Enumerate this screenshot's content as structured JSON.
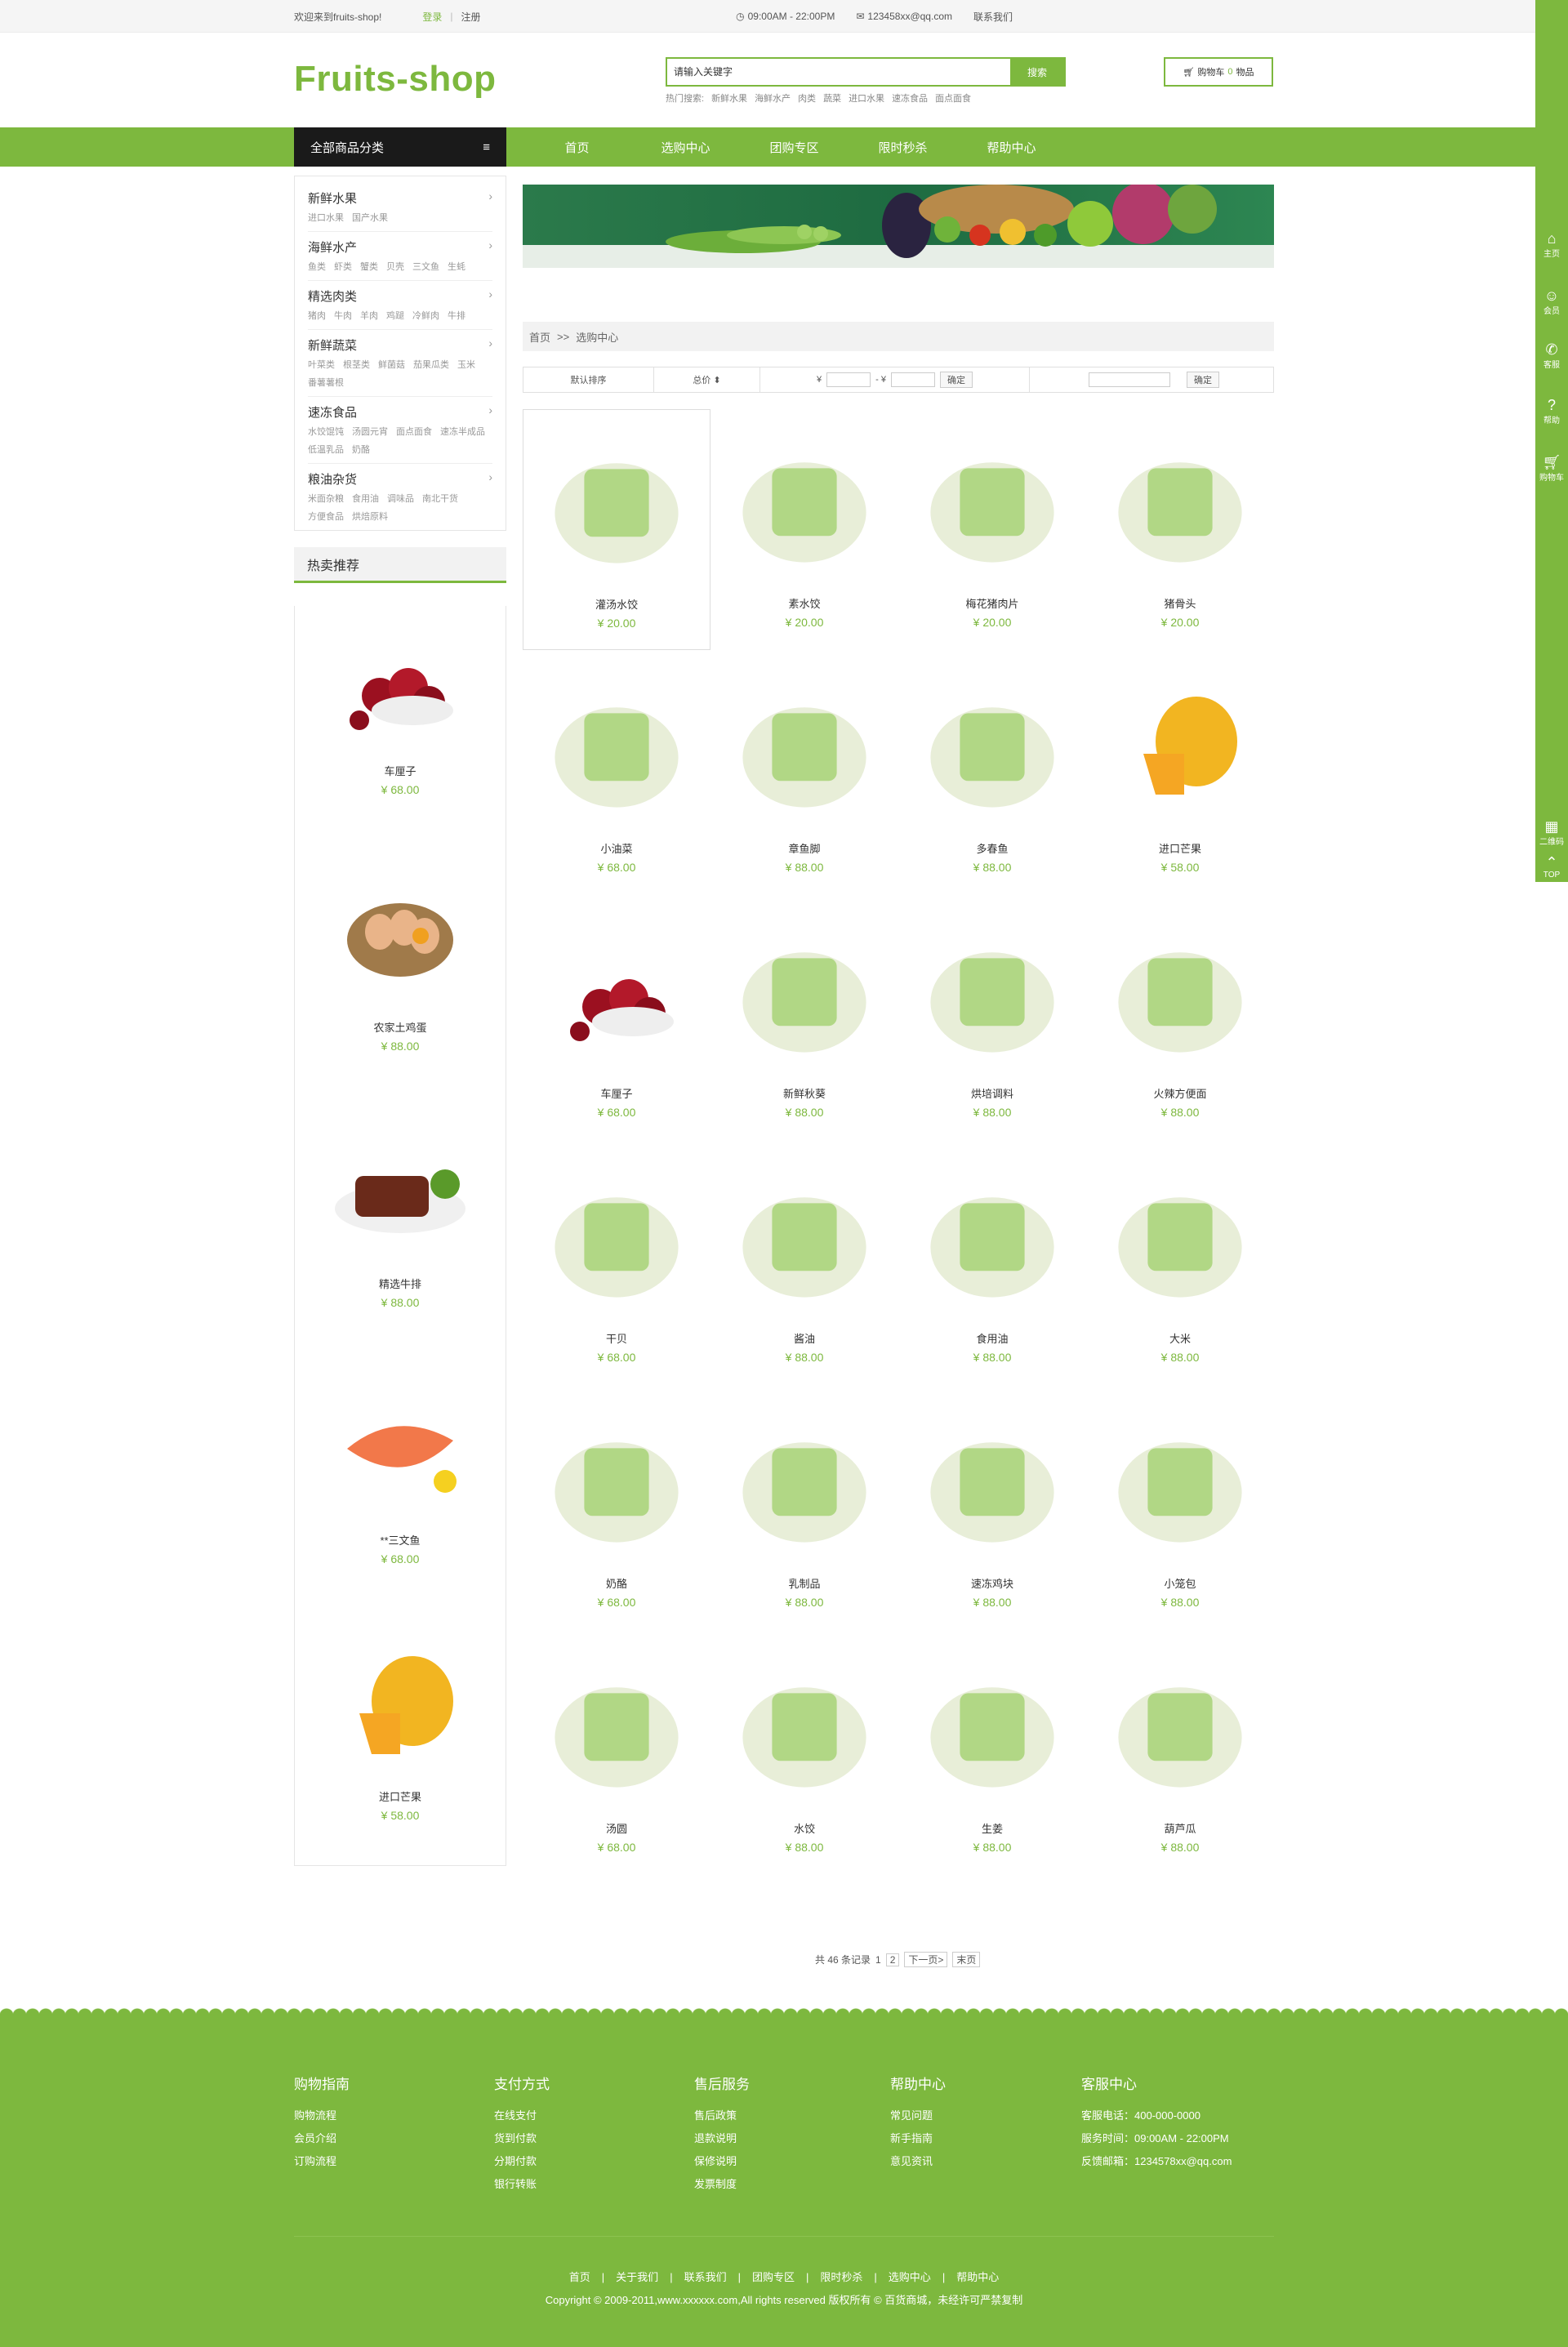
{
  "topbar": {
    "welcome": "欢迎来到fruits-shop!",
    "login": "登录",
    "register": "注册",
    "hours": "09:00AM - 22:00PM",
    "email": "123458xx@qq.com",
    "contact": "联系我们"
  },
  "logo": "Fruits-shop",
  "search": {
    "placeholder": "请输入关键字",
    "button": "搜索",
    "hot_label": "热门搜索:",
    "hot": [
      "新鲜水果",
      "海鲜水产",
      "肉类",
      "蔬菜",
      "进口水果",
      "速冻食品",
      "面点面食"
    ]
  },
  "cart": {
    "label": "购物车",
    "count": "0",
    "unit": "物品"
  },
  "nav": {
    "all_categories": "全部商品分类",
    "links": [
      "首页",
      "选购中心",
      "团购专区",
      "限时秒杀",
      "帮助中心"
    ]
  },
  "categories": [
    {
      "title": "新鲜水果",
      "subs": [
        "进口水果",
        "国产水果"
      ]
    },
    {
      "title": "海鲜水产",
      "subs": [
        "鱼类",
        "虾类",
        "蟹类",
        "贝壳",
        "三文鱼",
        "生蚝"
      ]
    },
    {
      "title": "精选肉类",
      "subs": [
        "猪肉",
        "牛肉",
        "羊肉",
        "鸡蹆",
        "冷鲜肉",
        "牛排"
      ]
    },
    {
      "title": "新鲜蔬菜",
      "subs": [
        "叶菜类",
        "根茎类",
        "鲜菌菇",
        "茄果瓜类",
        "玉米",
        "番薯薯根"
      ]
    },
    {
      "title": "速冻食品",
      "subs": [
        "水饺馄饨",
        "汤圆元宵",
        "面点面食",
        "速冻半成品",
        "低温乳品",
        "奶酪"
      ]
    },
    {
      "title": "粮油杂货",
      "subs": [
        "米面杂粮",
        "食用油",
        "调味品",
        "南北干货",
        "方便食品",
        "烘焙原料"
      ]
    }
  ],
  "hot": {
    "title": "热卖推荐",
    "items": [
      {
        "name": "车厘子",
        "price": "¥ 68.00"
      },
      {
        "name": "农家土鸡蛋",
        "price": "¥ 88.00"
      },
      {
        "name": "精选牛排",
        "price": "¥ 88.00"
      },
      {
        "name": "**三文鱼",
        "price": "¥ 68.00"
      },
      {
        "name": "进口芒果",
        "price": "¥ 58.00"
      }
    ]
  },
  "breadcrumb": {
    "home": "首页",
    "sep": ">>",
    "current": "选购中心"
  },
  "filter": {
    "default": "默认排序",
    "price": "总价 ⬍",
    "currency": "¥",
    "dash": "- ¥",
    "confirm": "确定",
    "confirm2": "确定"
  },
  "products": [
    {
      "name": "灌汤水饺",
      "price": "¥ 20.00"
    },
    {
      "name": "素水饺",
      "price": "¥ 20.00"
    },
    {
      "name": "梅花猪肉片",
      "price": "¥ 20.00"
    },
    {
      "name": "猪骨头",
      "price": "¥ 20.00"
    },
    {
      "name": "小油菜",
      "price": "¥ 68.00"
    },
    {
      "name": "章鱼脚",
      "price": "¥ 88.00"
    },
    {
      "name": "多春鱼",
      "price": "¥ 88.00"
    },
    {
      "name": "进口芒果",
      "price": "¥ 58.00"
    },
    {
      "name": "车厘子",
      "price": "¥ 68.00"
    },
    {
      "name": "新鲜秋葵",
      "price": "¥ 88.00"
    },
    {
      "name": "烘培调料",
      "price": "¥ 88.00"
    },
    {
      "name": "火辣方便面",
      "price": "¥ 88.00"
    },
    {
      "name": "干贝",
      "price": "¥ 68.00"
    },
    {
      "name": "酱油",
      "price": "¥ 88.00"
    },
    {
      "name": "食用油",
      "price": "¥ 88.00"
    },
    {
      "name": "大米",
      "price": "¥ 88.00"
    },
    {
      "name": "奶酪",
      "price": "¥ 68.00"
    },
    {
      "name": "乳制品",
      "price": "¥ 88.00"
    },
    {
      "name": "速冻鸡块",
      "price": "¥ 88.00"
    },
    {
      "name": "小笼包",
      "price": "¥ 88.00"
    },
    {
      "name": "汤圆",
      "price": "¥ 68.00"
    },
    {
      "name": "水饺",
      "price": "¥ 88.00"
    },
    {
      "name": "生姜",
      "price": "¥ 88.00"
    },
    {
      "name": "葫芦瓜",
      "price": "¥ 88.00"
    }
  ],
  "pager": {
    "total": "共 46 条记录",
    "p1": "1",
    "p2": "2",
    "next": "下一页>",
    "last": "末页"
  },
  "dock": [
    "主页",
    "会员",
    "客服",
    "帮助",
    "购物车",
    "二维码",
    "TOP"
  ],
  "footer": {
    "cols": [
      {
        "title": "购物指南",
        "items": [
          "购物流程",
          "会员介绍",
          "订购流程"
        ]
      },
      {
        "title": "支付方式",
        "items": [
          "在线支付",
          "货到付款",
          "分期付款",
          "银行转账"
        ]
      },
      {
        "title": "售后服务",
        "items": [
          "售后政策",
          "退款说明",
          "保修说明",
          "发票制度"
        ]
      },
      {
        "title": "帮助中心",
        "items": [
          "常见问题",
          "新手指南",
          "意见资讯"
        ]
      },
      {
        "title": "客服中心",
        "items": [
          "客服电话：400-000-0000",
          "服务时间：09:00AM - 22:00PM",
          "反馈邮箱：1234578xx@qq.com"
        ]
      }
    ],
    "links": [
      "首页",
      "关于我们",
      "联系我们",
      "团购专区",
      "限时秒杀",
      "选购中心",
      "帮助中心"
    ],
    "copyright": "Copyright © 2009-2011,www.xxxxxx.com,All rights reserved 版权所有 © 百货商城，未经许可严禁复制"
  },
  "colors": {
    "accent": "#7db83e",
    "dark": "#1a1a1a"
  }
}
